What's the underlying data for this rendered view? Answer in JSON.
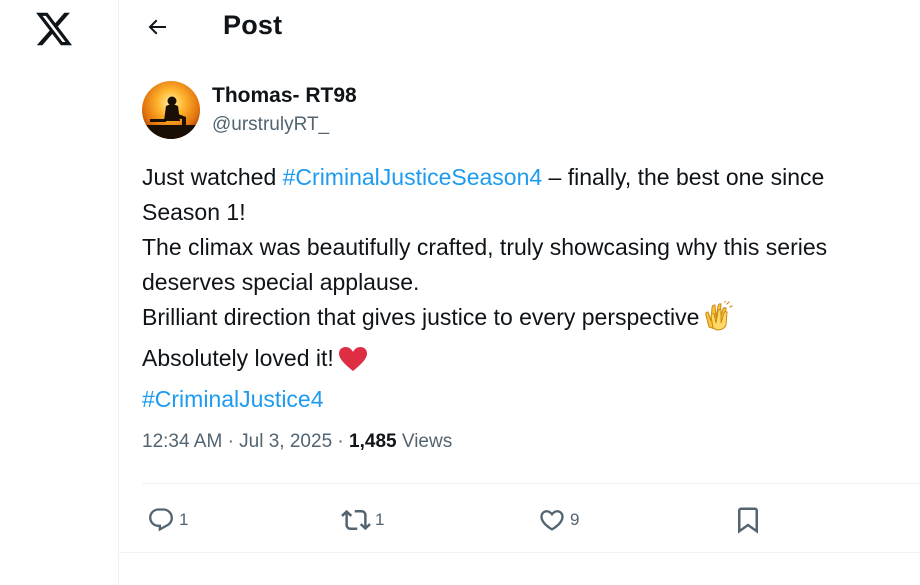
{
  "header": {
    "title": "Post"
  },
  "author": {
    "display_name": "Thomas- RT98",
    "handle": "@urstrulyRT_"
  },
  "tweet": {
    "line1_pre": "Just watched ",
    "line1_hashtag": "#CriminalJusticeSeason4",
    "line1_post": " – finally, the best one since",
    "line2": "Season 1!",
    "line3": "The climax was beautifully crafted, truly showcasing why this series",
    "line4": "deserves special applause.",
    "line5": "Brilliant direction that gives justice to every perspective",
    "line6": "Absolutely loved it!",
    "line7_hashtag": "#CriminalJustice4"
  },
  "meta": {
    "time": "12:34 AM",
    "separator": "·",
    "date": "Jul 3, 2025",
    "views_count": "1,485",
    "views_label": "Views"
  },
  "actions": {
    "reply_count": "1",
    "repost_count": "1",
    "like_count": "9"
  },
  "icons": [
    "x-logo-icon",
    "back-arrow-icon",
    "clapping-hands-icon",
    "red-heart-icon",
    "reply-icon",
    "repost-icon",
    "like-icon",
    "bookmark-icon"
  ],
  "colors": {
    "link": "#1d9bf0",
    "secondary_text": "#536471",
    "text": "#0f1419",
    "divider": "#eff3f4"
  }
}
